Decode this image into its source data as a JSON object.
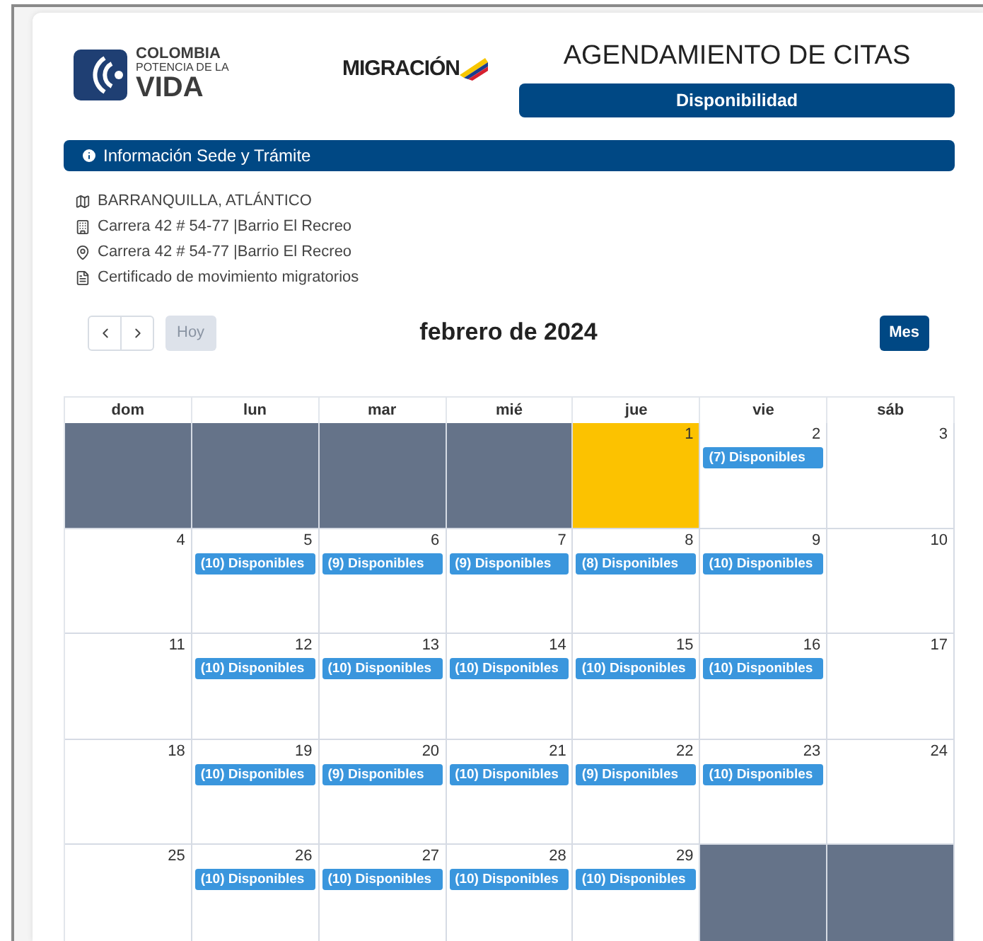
{
  "header": {
    "logo_lines": [
      "COLOMBIA",
      "POTENCIA DE LA",
      "VIDA"
    ],
    "agency_logo": "MIGRACIÓN",
    "title": "AGENDAMIENTO DE CITAS",
    "subtitle": "Disponibilidad"
  },
  "info_bar": {
    "label": "Información Sede y Trámite"
  },
  "details": [
    {
      "kind": "city",
      "text": "BARRANQUILLA, ATLÁNTICO"
    },
    {
      "kind": "building",
      "text": "Carrera 42 # 54-77 |Barrio El Recreo"
    },
    {
      "kind": "pin",
      "text": "Carrera 42 # 54-77 |Barrio El Recreo"
    },
    {
      "kind": "document",
      "text": "Certificado de movimiento migratorios"
    }
  ],
  "toolbar": {
    "today": {
      "label": "Hoy",
      "disabled": true
    },
    "month": "febrero de 2024",
    "view": "Mes"
  },
  "calendar": {
    "weekdays": [
      "dom",
      "lun",
      "mar",
      "mié",
      "jue",
      "vie",
      "sáb"
    ],
    "weeks": [
      [
        {
          "kind": "outside"
        },
        {
          "kind": "outside"
        },
        {
          "kind": "outside"
        },
        {
          "kind": "outside"
        },
        {
          "kind": "today",
          "day": "1"
        },
        {
          "kind": "normal",
          "day": "2",
          "events": [
            "(7) Disponibles"
          ]
        },
        {
          "kind": "normal",
          "day": "3"
        }
      ],
      [
        {
          "kind": "normal",
          "day": "4"
        },
        {
          "kind": "normal",
          "day": "5",
          "events": [
            "(10) Disponibles"
          ]
        },
        {
          "kind": "normal",
          "day": "6",
          "events": [
            "(9) Disponibles"
          ]
        },
        {
          "kind": "normal",
          "day": "7",
          "events": [
            "(9) Disponibles"
          ]
        },
        {
          "kind": "normal",
          "day": "8",
          "events": [
            "(8) Disponibles"
          ]
        },
        {
          "kind": "normal",
          "day": "9",
          "events": [
            "(10) Disponibles"
          ]
        },
        {
          "kind": "normal",
          "day": "10"
        }
      ],
      [
        {
          "kind": "normal",
          "day": "11"
        },
        {
          "kind": "normal",
          "day": "12",
          "events": [
            "(10) Disponibles"
          ]
        },
        {
          "kind": "normal",
          "day": "13",
          "events": [
            "(10) Disponibles"
          ]
        },
        {
          "kind": "normal",
          "day": "14",
          "events": [
            "(10) Disponibles"
          ]
        },
        {
          "kind": "normal",
          "day": "15",
          "events": [
            "(10) Disponibles"
          ]
        },
        {
          "kind": "normal",
          "day": "16",
          "events": [
            "(10) Disponibles"
          ]
        },
        {
          "kind": "normal",
          "day": "17"
        }
      ],
      [
        {
          "kind": "normal",
          "day": "18"
        },
        {
          "kind": "normal",
          "day": "19",
          "events": [
            "(10) Disponibles"
          ]
        },
        {
          "kind": "normal",
          "day": "20",
          "events": [
            "(9) Disponibles"
          ]
        },
        {
          "kind": "normal",
          "day": "21",
          "events": [
            "(10) Disponibles"
          ]
        },
        {
          "kind": "normal",
          "day": "22",
          "events": [
            "(9) Disponibles"
          ]
        },
        {
          "kind": "normal",
          "day": "23",
          "events": [
            "(10) Disponibles"
          ]
        },
        {
          "kind": "normal",
          "day": "24"
        }
      ],
      [
        {
          "kind": "normal",
          "day": "25"
        },
        {
          "kind": "normal",
          "day": "26",
          "events": [
            "(10) Disponibles"
          ]
        },
        {
          "kind": "normal",
          "day": "27",
          "events": [
            "(10) Disponibles"
          ]
        },
        {
          "kind": "normal",
          "day": "28",
          "events": [
            "(10) Disponibles"
          ]
        },
        {
          "kind": "normal",
          "day": "29",
          "events": [
            "(10) Disponibles"
          ]
        },
        {
          "kind": "outside"
        },
        {
          "kind": "outside"
        }
      ]
    ]
  }
}
